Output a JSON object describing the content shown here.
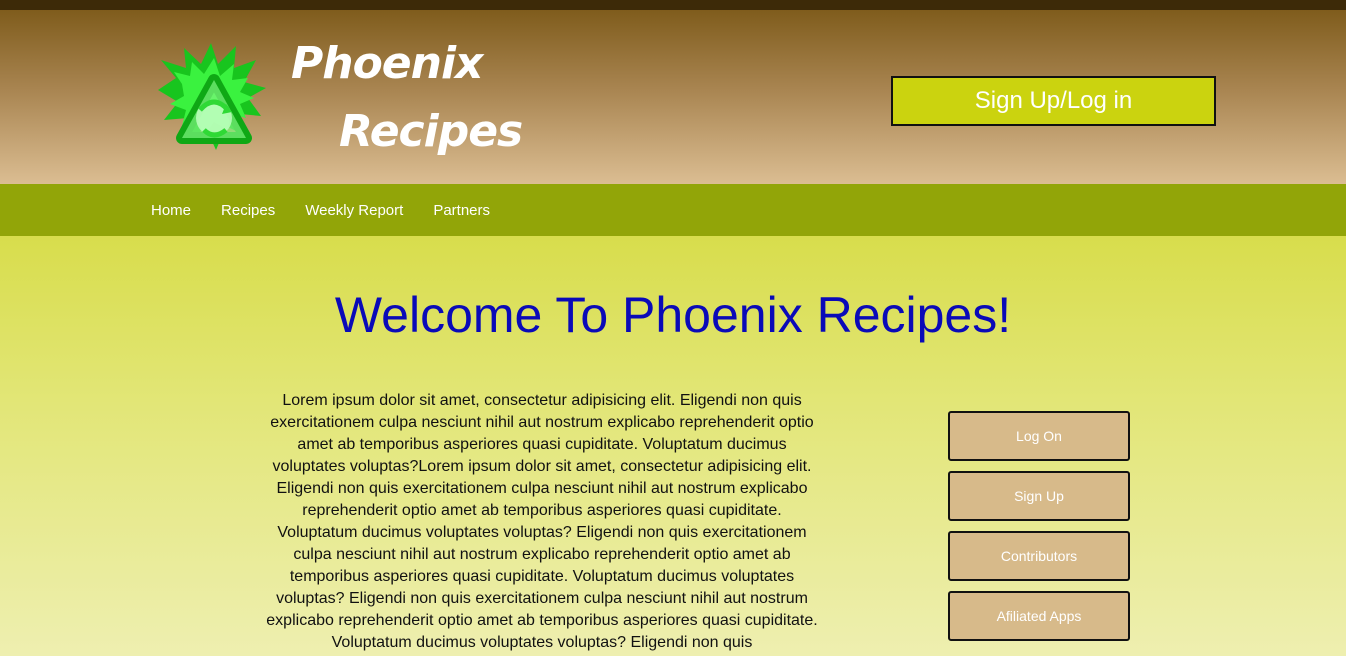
{
  "header": {
    "brand_line1": "Phoenix",
    "brand_line2": "Recipes",
    "signup_label": "Sign Up/Log in",
    "logo_icon": "phoenix-recycle-logo-icon"
  },
  "nav": {
    "items": [
      {
        "label": "Home"
      },
      {
        "label": "Recipes"
      },
      {
        "label": "Weekly Report"
      },
      {
        "label": "Partners"
      }
    ]
  },
  "main": {
    "title": "Welcome To Phoenix Recipes!",
    "body": "Lorem ipsum dolor sit amet, consectetur adipisicing elit. Eligendi non quis exercitationem culpa nesciunt nihil aut nostrum explicabo reprehenderit optio amet ab temporibus asperiores quasi cupiditate. Voluptatum ducimus voluptates voluptas?Lorem ipsum dolor sit amet, consectetur adipisicing elit. Eligendi non quis exercitationem culpa nesciunt nihil aut nostrum explicabo reprehenderit optio amet ab temporibus asperiores quasi cupiditate. Voluptatum ducimus voluptates voluptas? Eligendi non quis exercitationem culpa nesciunt nihil aut nostrum explicabo reprehenderit optio amet ab temporibus asperiores quasi cupiditate. Voluptatum ducimus voluptates voluptas? Eligendi non quis exercitationem culpa nesciunt nihil aut nostrum explicabo reprehenderit optio amet ab temporibus asperiores quasi cupiditate. Voluptatum ducimus voluptates voluptas? Eligendi non quis"
  },
  "sidebar": {
    "buttons": [
      {
        "label": "Log On"
      },
      {
        "label": "Sign Up"
      },
      {
        "label": "Contributors"
      },
      {
        "label": "Afiliated Apps"
      }
    ]
  },
  "colors": {
    "header_top": "#7f5c1c",
    "header_bottom": "#dbbd92",
    "nav_bg": "#92a508",
    "signup_bg": "#cbd30f",
    "title_blue": "#0a0ab8",
    "side_button_bg": "#d7ba8a",
    "logo_green": "#22e02a"
  }
}
